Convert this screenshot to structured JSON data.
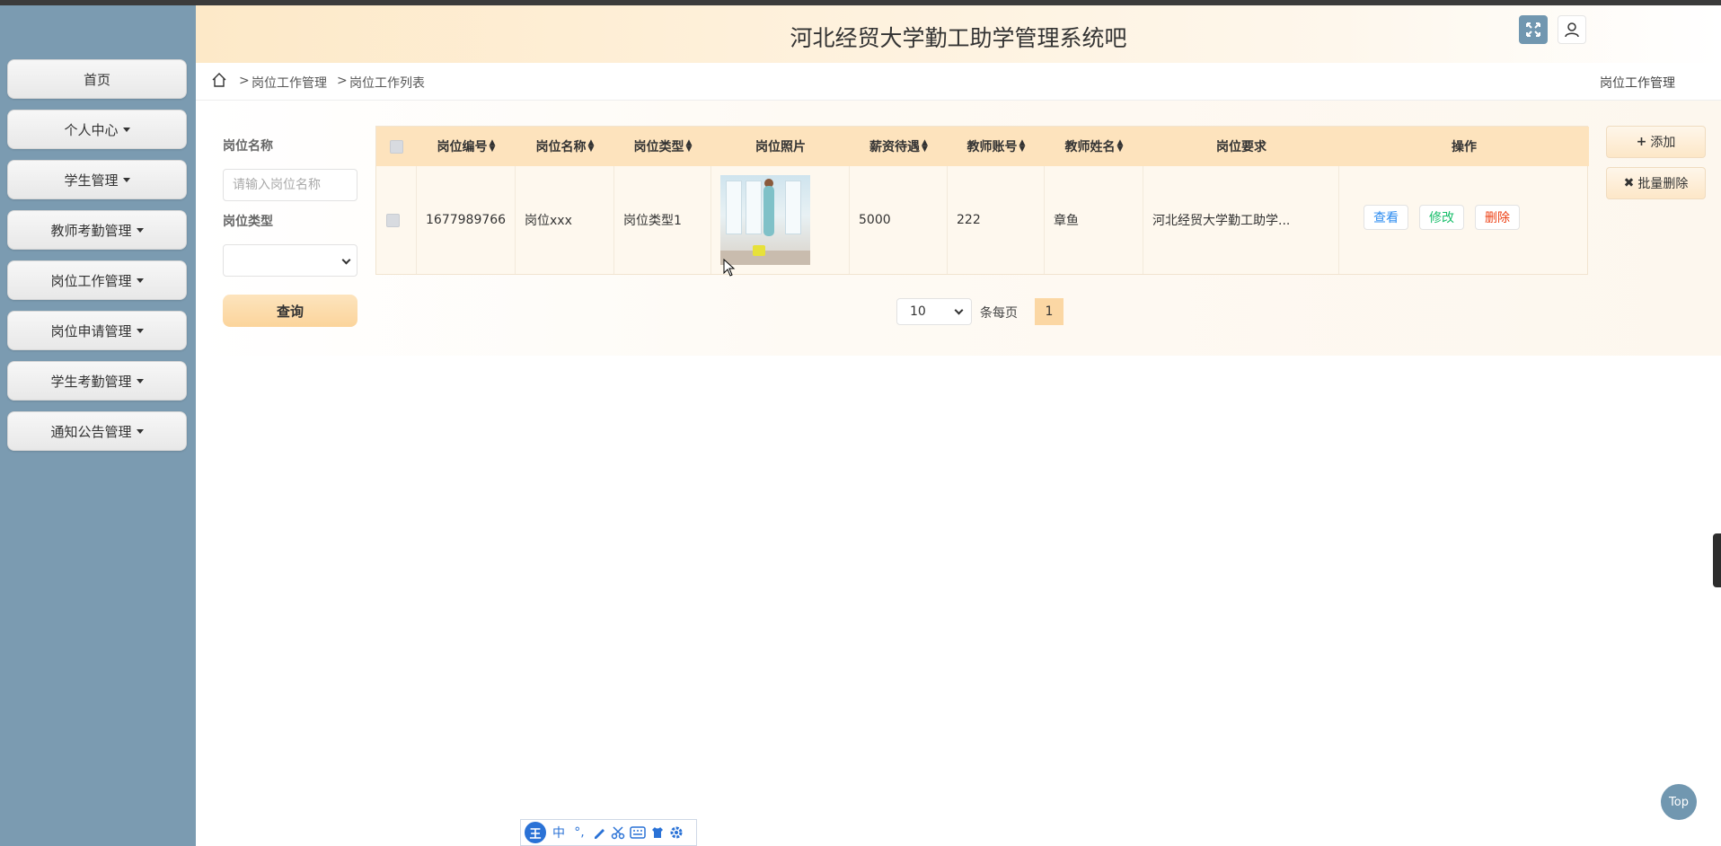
{
  "header": {
    "title": "河北经贸大学勤工助学管理系统吧"
  },
  "sidebar": {
    "items": [
      {
        "label": "首页",
        "dropdown": false
      },
      {
        "label": "个人中心",
        "dropdown": true
      },
      {
        "label": "学生管理",
        "dropdown": true
      },
      {
        "label": "教师考勤管理",
        "dropdown": true
      },
      {
        "label": "岗位工作管理",
        "dropdown": true
      },
      {
        "label": "岗位申请管理",
        "dropdown": true
      },
      {
        "label": "学生考勤管理",
        "dropdown": true
      },
      {
        "label": "通知公告管理",
        "dropdown": true
      }
    ]
  },
  "breadcrumb": {
    "sep": ">",
    "level1": "岗位工作管理",
    "level2": "岗位工作列表",
    "right": "岗位工作管理"
  },
  "search": {
    "name_label": "岗位名称",
    "name_placeholder": "请输入岗位名称",
    "type_label": "岗位类型",
    "type_value": "",
    "button": "查询"
  },
  "table": {
    "headers": [
      "岗位编号",
      "岗位名称",
      "岗位类型",
      "岗位照片",
      "薪资待遇",
      "教师账号",
      "教师姓名",
      "岗位要求",
      "操作"
    ],
    "rows": [
      {
        "id": "1677989766",
        "name": "岗位xxx",
        "type": "岗位类型1",
        "salary": "5000",
        "teacher_account": "222",
        "teacher_name": "章鱼",
        "requirement": "河北经贸大学勤工助学..."
      }
    ],
    "actions": {
      "view": "查看",
      "edit": "修改",
      "delete": "删除"
    }
  },
  "toolbar": {
    "add": "添加",
    "batch_delete": "批量删除"
  },
  "pagination": {
    "page_size": "10",
    "per_page_label": "条每页",
    "current_page": "1"
  },
  "top_button": "Top",
  "ime": {
    "logo": "王",
    "mode": "中",
    "punct": "°,"
  },
  "colors": {
    "sidebar": "#7b9bb1",
    "accent": "#fbd7a4",
    "view": "#2d8cf0",
    "edit": "#19be6b",
    "delete": "#ed4014"
  }
}
